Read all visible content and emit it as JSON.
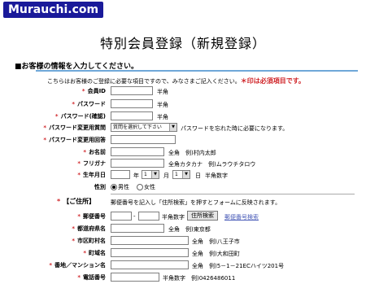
{
  "header": {
    "logo": "Murauchi.com"
  },
  "page": {
    "title": "特別会員登録（新規登録）",
    "section_title": "■お客様の情報を入力してください。",
    "intro": "こちらはお客様のご登録に必要な項目ですので、みなさまご記入ください。",
    "required_note": "＊印は必須項目です。"
  },
  "form": {
    "member_id": {
      "label": "会員ID",
      "hint": "半角"
    },
    "password": {
      "label": "パスワード",
      "hint": "半角"
    },
    "password_confirm": {
      "label": "パスワード(確認)",
      "hint": "半角"
    },
    "question": {
      "label": "パスワード変更用質問",
      "selected": "質問を選択して下さい",
      "hint": "パスワードを忘れた時に必要になります。"
    },
    "answer": {
      "label": "パスワード変更用回答"
    },
    "name": {
      "label": "お名前",
      "hint": "全角　例)村内太郎"
    },
    "furigana": {
      "label": "フリガナ",
      "hint": "全角カタカナ　例)ムラウチタロウ"
    },
    "birthday": {
      "label": "生年月日",
      "year_unit": "年",
      "month_value": "1",
      "month_unit": "月",
      "day_value": "1",
      "day_unit": "日",
      "hint": "半角数字"
    },
    "gender": {
      "label": "性別",
      "male": "男性",
      "female": "女性",
      "selected": "男性"
    },
    "address": {
      "heading": "【ご住所】",
      "note": "郵便番号を記入し「住所検索」を押すとフォームに反映されます。"
    },
    "postal": {
      "label": "郵便番号",
      "separator": "-",
      "hint": "半角数字",
      "search_button": "住所検索",
      "search_link": "郵便番号検索"
    },
    "prefecture": {
      "label": "都道府県名",
      "hint": "全角　例)東京都"
    },
    "city": {
      "label": "市区町村名",
      "hint": "全角　例)八王子市"
    },
    "town": {
      "label": "町域名",
      "hint": "全角　例)大和田町"
    },
    "street": {
      "label": "番地／マンション名",
      "hint": "全角　例)5－1－21ECハイツ201号"
    },
    "phone": {
      "label": "電話番号",
      "hint": "半角数字　例)0426486011"
    }
  },
  "colors": {
    "required": "#d0262a",
    "rule": "#6fa8d8",
    "logo_bg": "#1a1a9a",
    "link": "#4a5cb8"
  }
}
